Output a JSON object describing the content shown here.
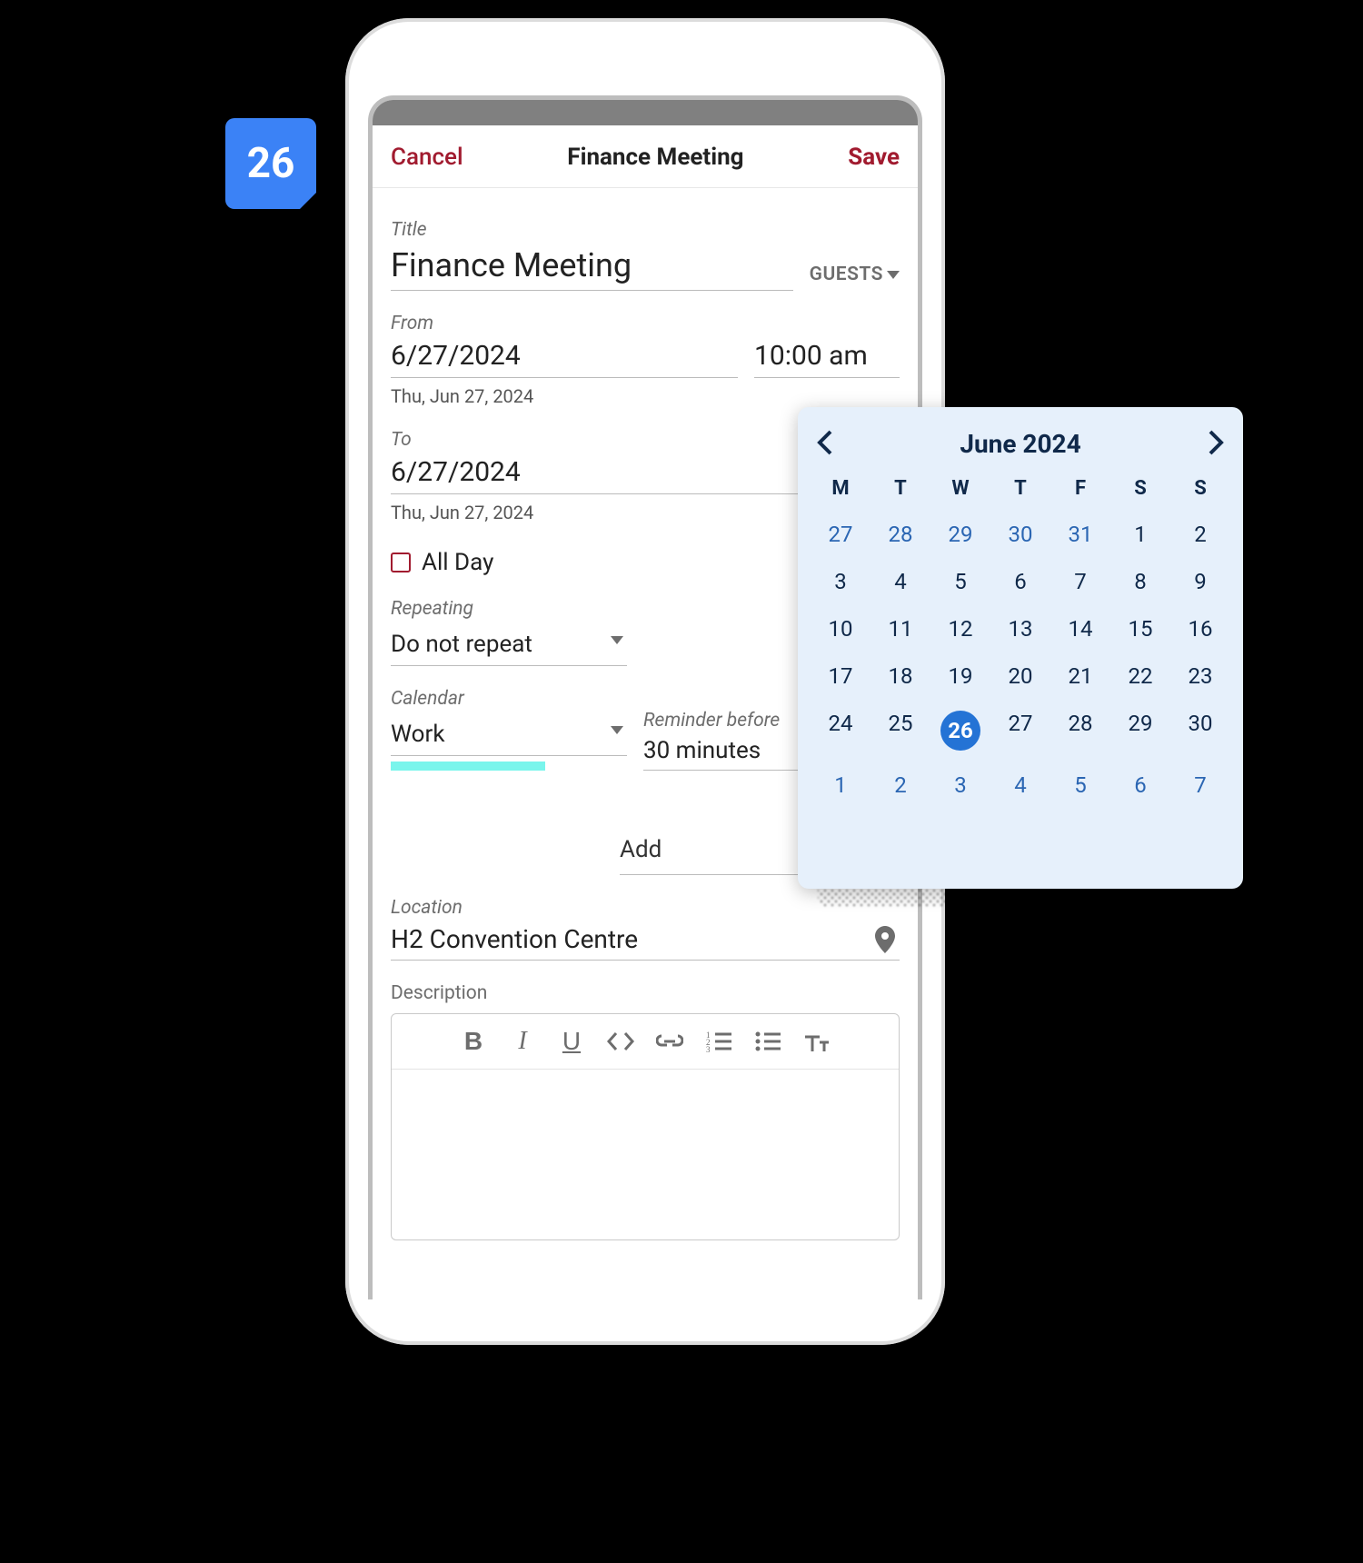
{
  "badge": {
    "day": "26"
  },
  "topbar": {
    "cancel": "Cancel",
    "title": "Finance Meeting",
    "save": "Save"
  },
  "event": {
    "title_label": "Title",
    "title_value": "Finance Meeting",
    "guests_label": "GUESTS",
    "from_label": "From",
    "from_date": "6/27/2024",
    "from_time": "10:00 am",
    "from_sub": "Thu, Jun 27, 2024",
    "to_label": "To",
    "to_date": "6/27/2024",
    "to_sub": "Thu, Jun 27, 2024",
    "allday_label": "All Day",
    "repeating_label": "Repeating",
    "repeating_value": "Do not repeat",
    "calendar_label": "Calendar",
    "calendar_value": "Work",
    "reminder_label": "Reminder before",
    "reminder_value": "30 minutes",
    "add_label": "Add",
    "location_label": "Location",
    "location_value": "H2 Convention Centre",
    "description_label": "Description"
  },
  "calendar_popup": {
    "month_label": "June 2024",
    "dow": [
      "M",
      "T",
      "W",
      "T",
      "F",
      "S",
      "S"
    ],
    "weeks": [
      [
        {
          "d": "27",
          "other": true
        },
        {
          "d": "28",
          "other": true
        },
        {
          "d": "29",
          "other": true
        },
        {
          "d": "30",
          "other": true
        },
        {
          "d": "31",
          "other": true
        },
        {
          "d": "1"
        },
        {
          "d": "2"
        }
      ],
      [
        {
          "d": "3"
        },
        {
          "d": "4"
        },
        {
          "d": "5"
        },
        {
          "d": "6"
        },
        {
          "d": "7"
        },
        {
          "d": "8"
        },
        {
          "d": "9"
        }
      ],
      [
        {
          "d": "10"
        },
        {
          "d": "11"
        },
        {
          "d": "12"
        },
        {
          "d": "13"
        },
        {
          "d": "14"
        },
        {
          "d": "15"
        },
        {
          "d": "16"
        }
      ],
      [
        {
          "d": "17"
        },
        {
          "d": "18"
        },
        {
          "d": "19"
        },
        {
          "d": "20"
        },
        {
          "d": "21"
        },
        {
          "d": "22"
        },
        {
          "d": "23"
        }
      ],
      [
        {
          "d": "24"
        },
        {
          "d": "25"
        },
        {
          "d": "26",
          "selected": true
        },
        {
          "d": "27"
        },
        {
          "d": "28"
        },
        {
          "d": "29"
        },
        {
          "d": "30"
        }
      ],
      [
        {
          "d": "1",
          "other": true
        },
        {
          "d": "2",
          "other": true
        },
        {
          "d": "3",
          "other": true
        },
        {
          "d": "4",
          "other": true
        },
        {
          "d": "5",
          "other": true
        },
        {
          "d": "6",
          "other": true
        },
        {
          "d": "7",
          "other": true
        }
      ]
    ]
  }
}
